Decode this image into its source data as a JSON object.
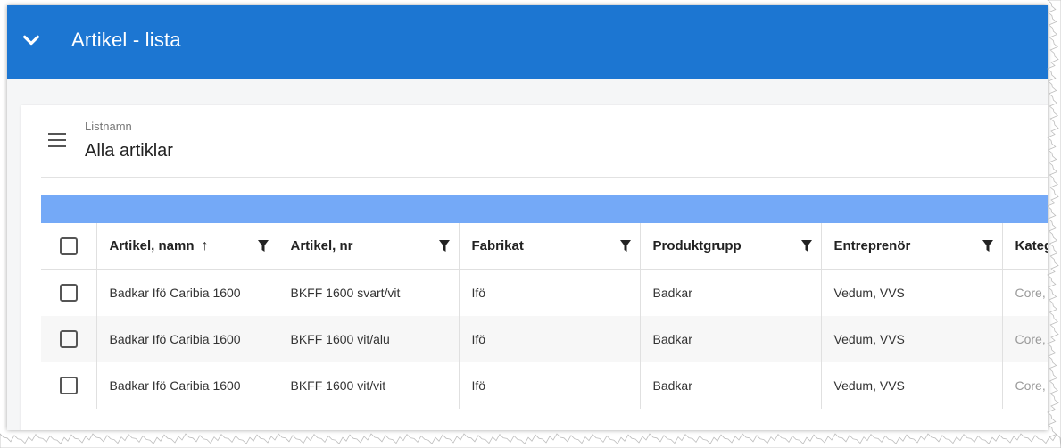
{
  "header": {
    "title": "Artikel - lista",
    "collapse_icon": "chevron-down-icon",
    "background": "#1c76d2"
  },
  "list": {
    "label": "Listnamn",
    "name": "Alla artiklar",
    "menu_icon": "hamburger-menu-icon"
  },
  "toolbar_color": "#74a9f7",
  "table": {
    "columns": [
      {
        "label": "Artikel, namn",
        "sorted": "ascending"
      },
      {
        "label": "Artikel, nr"
      },
      {
        "label": "Fabrikat"
      },
      {
        "label": "Produktgrupp"
      },
      {
        "label": "Entreprenör"
      },
      {
        "label": "Kateg"
      }
    ],
    "sort_glyph": "↑",
    "rows": [
      [
        "Badkar Ifö Caribia 1600",
        "BKFF 1600 svart/vit",
        "Ifö",
        "Badkar",
        "Vedum, VVS",
        "Core, P"
      ],
      [
        "Badkar Ifö Caribia 1600",
        "BKFF 1600 vit/alu",
        "Ifö",
        "Badkar",
        "Vedum, VVS",
        "Core, P"
      ],
      [
        "Badkar Ifö Caribia 1600",
        "BKFF 1600 vit/vit",
        "Ifö",
        "Badkar",
        "Vedum, VVS",
        "Core, P"
      ]
    ]
  }
}
